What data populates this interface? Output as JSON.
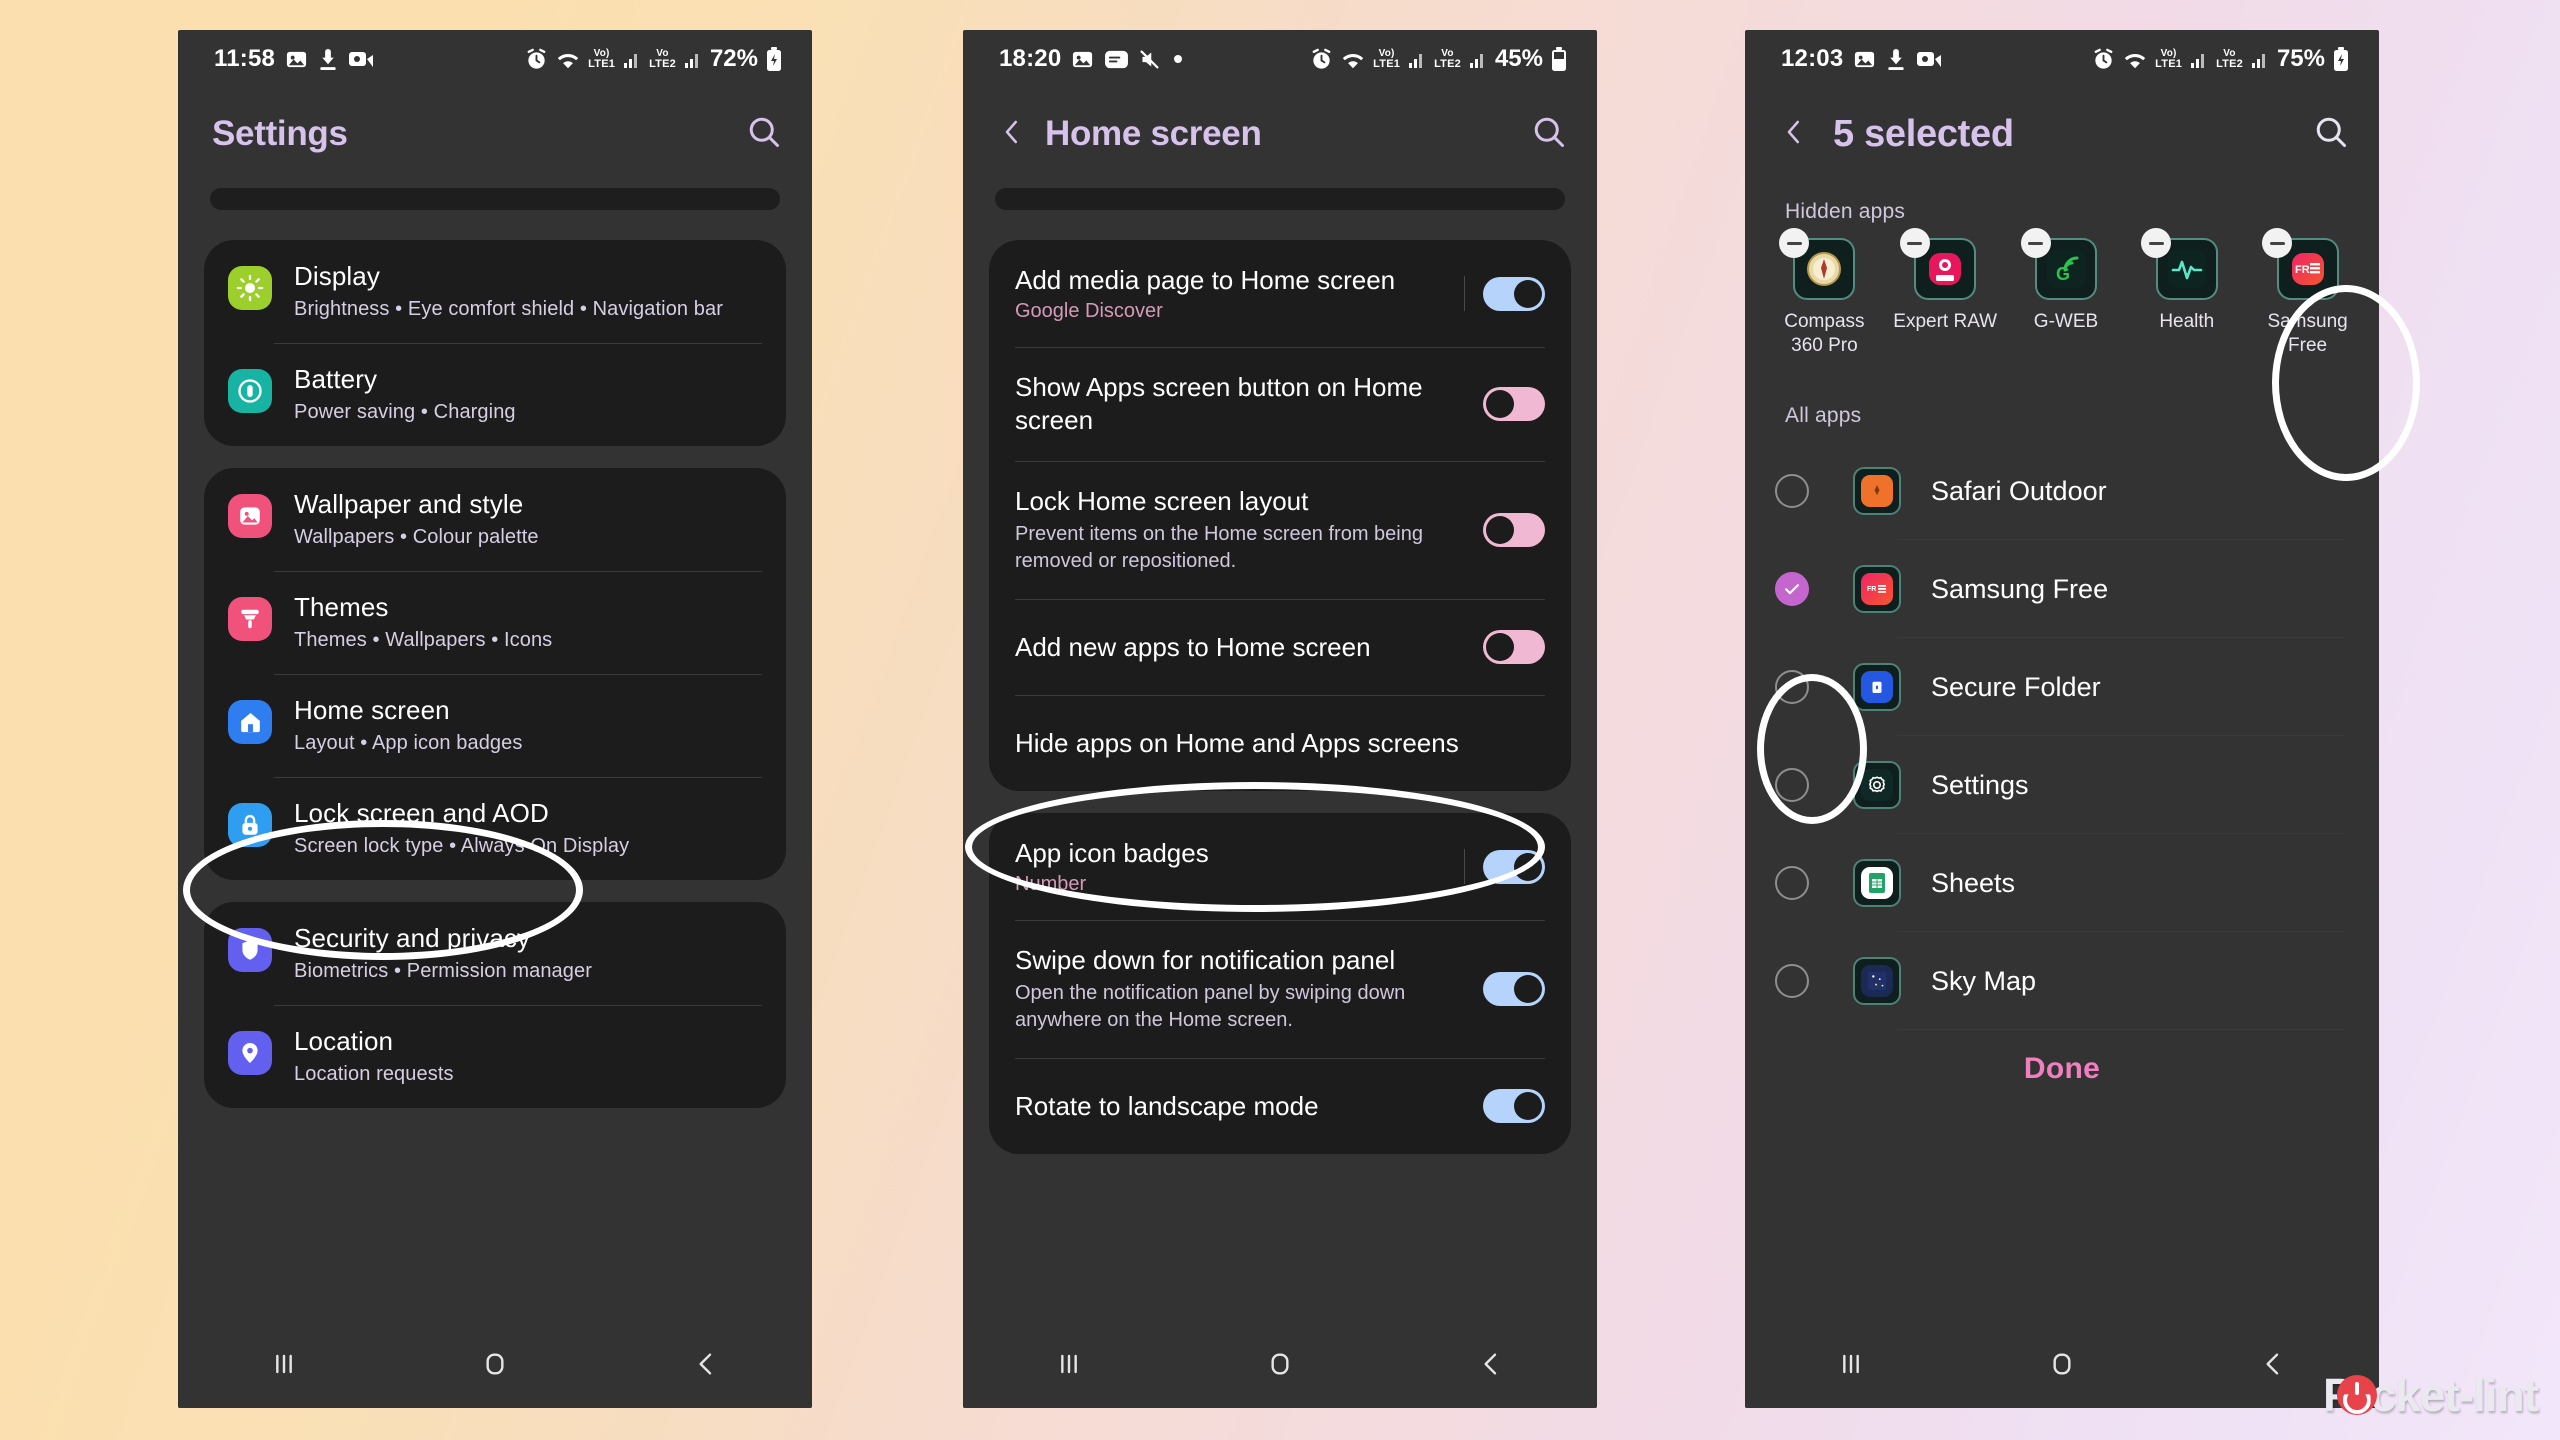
{
  "watermark": {
    "text": "Pocket-lint"
  },
  "panel1": {
    "status": {
      "time": "11:58",
      "battery": "72%",
      "lte1": "LTE1",
      "lte2": "LTE2",
      "vo": "Vo)"
    },
    "header": {
      "title": "Settings"
    },
    "groups": [
      {
        "rows": [
          {
            "title": "Display",
            "sub": "Brightness  •  Eye comfort shield  •  Navigation bar",
            "icon": "brightness-icon",
            "color": "#9ccf2b"
          },
          {
            "title": "Battery",
            "sub": "Power saving  •  Charging",
            "icon": "battery-icon",
            "color": "#17b3a3"
          }
        ]
      },
      {
        "rows": [
          {
            "title": "Wallpaper and style",
            "sub": "Wallpapers  •  Colour palette",
            "icon": "image-icon",
            "color": "#f0527c"
          },
          {
            "title": "Themes",
            "sub": "Themes  •  Wallpapers  •  Icons",
            "icon": "brush-icon",
            "color": "#f0527c"
          },
          {
            "title": "Home screen",
            "sub": "Layout  •  App icon badges",
            "icon": "home-icon",
            "color": "#2f7ef0"
          },
          {
            "title": "Lock screen and AOD",
            "sub": "Screen lock type  •  Always On Display",
            "icon": "lock-icon",
            "color": "#2f9ef0"
          }
        ]
      },
      {
        "rows": [
          {
            "title": "Security and privacy",
            "sub": "Biometrics  •  Permission manager",
            "icon": "shield-icon",
            "color": "#6360f0"
          },
          {
            "title": "Location",
            "sub": "Location requests",
            "icon": "pin-icon",
            "color": "#6360f0"
          }
        ]
      }
    ]
  },
  "panel2": {
    "status": {
      "time": "18:20",
      "battery": "45%",
      "lte1": "LTE1",
      "lte2": "LTE2",
      "vo": "Vo)"
    },
    "header": {
      "title": "Home screen"
    },
    "group1": [
      {
        "title": "Add media page to Home screen",
        "sub": "Google Discover",
        "sub_accent": true,
        "toggle": "on",
        "divider": true
      },
      {
        "title": "Show Apps screen button on Home screen",
        "sub": "",
        "toggle": "off",
        "divider": false
      },
      {
        "title": "Lock Home screen layout",
        "sub": "Prevent items on the Home screen from being removed or repositioned.",
        "sub_accent": false,
        "toggle": "off",
        "divider": false
      },
      {
        "title": "Add new apps to Home screen",
        "sub": "",
        "toggle": "off",
        "divider": false
      },
      {
        "title": "Hide apps on Home and Apps screens",
        "sub": "",
        "toggle": "none",
        "divider": false
      }
    ],
    "group2": [
      {
        "title": "App icon badges",
        "sub": "Number",
        "sub_accent": true,
        "toggle": "on",
        "divider": true
      },
      {
        "title": "Swipe down for notification panel",
        "sub": "Open the notification panel by swiping down anywhere on the Home screen.",
        "sub_accent": false,
        "toggle": "on",
        "divider": false
      },
      {
        "title": "Rotate to landscape mode",
        "sub": "",
        "toggle": "on",
        "divider": false
      }
    ]
  },
  "panel3": {
    "status": {
      "time": "12:03",
      "battery": "75%",
      "lte1": "LTE1",
      "lte2": "LTE2",
      "vo": "Vo)"
    },
    "header": {
      "title": "5 selected"
    },
    "hidden_label": "Hidden apps",
    "hidden_apps": [
      {
        "name": "Compass 360 Pro",
        "icon": "compass-icon"
      },
      {
        "name": "Expert RAW",
        "icon": "camera-raw-icon"
      },
      {
        "name": "G-WEB",
        "icon": "g-web-icon"
      },
      {
        "name": "Health",
        "icon": "heartbeat-icon"
      },
      {
        "name": "Samsung Free",
        "icon": "samsung-free-icon"
      }
    ],
    "all_label": "All apps",
    "all_apps": [
      {
        "name": "Safari Outdoor",
        "icon": "safari-outdoor-icon",
        "checked": false
      },
      {
        "name": "Samsung Free",
        "icon": "samsung-free-icon",
        "checked": true
      },
      {
        "name": "Secure Folder",
        "icon": "secure-folder-icon",
        "checked": false
      },
      {
        "name": "Settings",
        "icon": "gear-icon",
        "checked": false
      },
      {
        "name": "Sheets",
        "icon": "sheets-icon",
        "checked": false
      },
      {
        "name": "Sky Map",
        "icon": "sky-map-icon",
        "checked": false
      }
    ],
    "done_label": "Done"
  },
  "colors": {
    "accent_pink": "#f07fc0",
    "title_purple": "#d6c2ea",
    "toggle_on": "#b6d4fb",
    "toggle_off": "#f0b8d2",
    "checked": "#c466cd"
  }
}
